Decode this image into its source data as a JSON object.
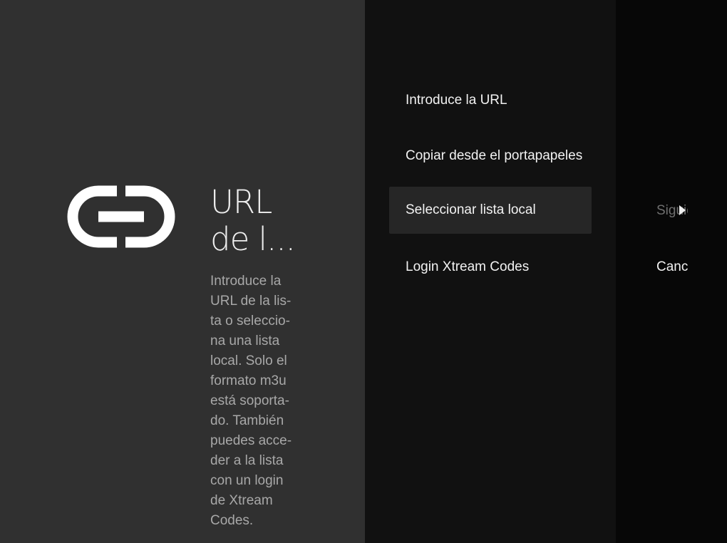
{
  "guidance": {
    "icon": "link-icon",
    "title_lines": [
      "URL",
      "de l..."
    ],
    "description_lines": [
      "Introduce la",
      "URL de la lis-",
      "ta o seleccio-",
      "na una lista",
      "local. Solo el",
      "formato m3u",
      "está soporta-",
      "do. También",
      "puedes acce-",
      "der a la lista",
      "con un login",
      "de Xtream",
      "Codes."
    ]
  },
  "actions": [
    {
      "label": "Introduce la URL",
      "selected": false
    },
    {
      "label": "Copiar desde el portapapeles",
      "selected": false
    },
    {
      "label": "Seleccionar lista local",
      "selected": true
    },
    {
      "label": "Login Xtream Codes",
      "selected": false
    }
  ],
  "buttons": {
    "next_label": "Siguiente",
    "next_icon": "chevron-right-icon",
    "cancel_label": "Cancelar"
  },
  "colors": {
    "guidance_bg": "#303030",
    "actions_bg": "#111111",
    "buttons_bg": "#070707",
    "selected_bg": "#262626"
  }
}
